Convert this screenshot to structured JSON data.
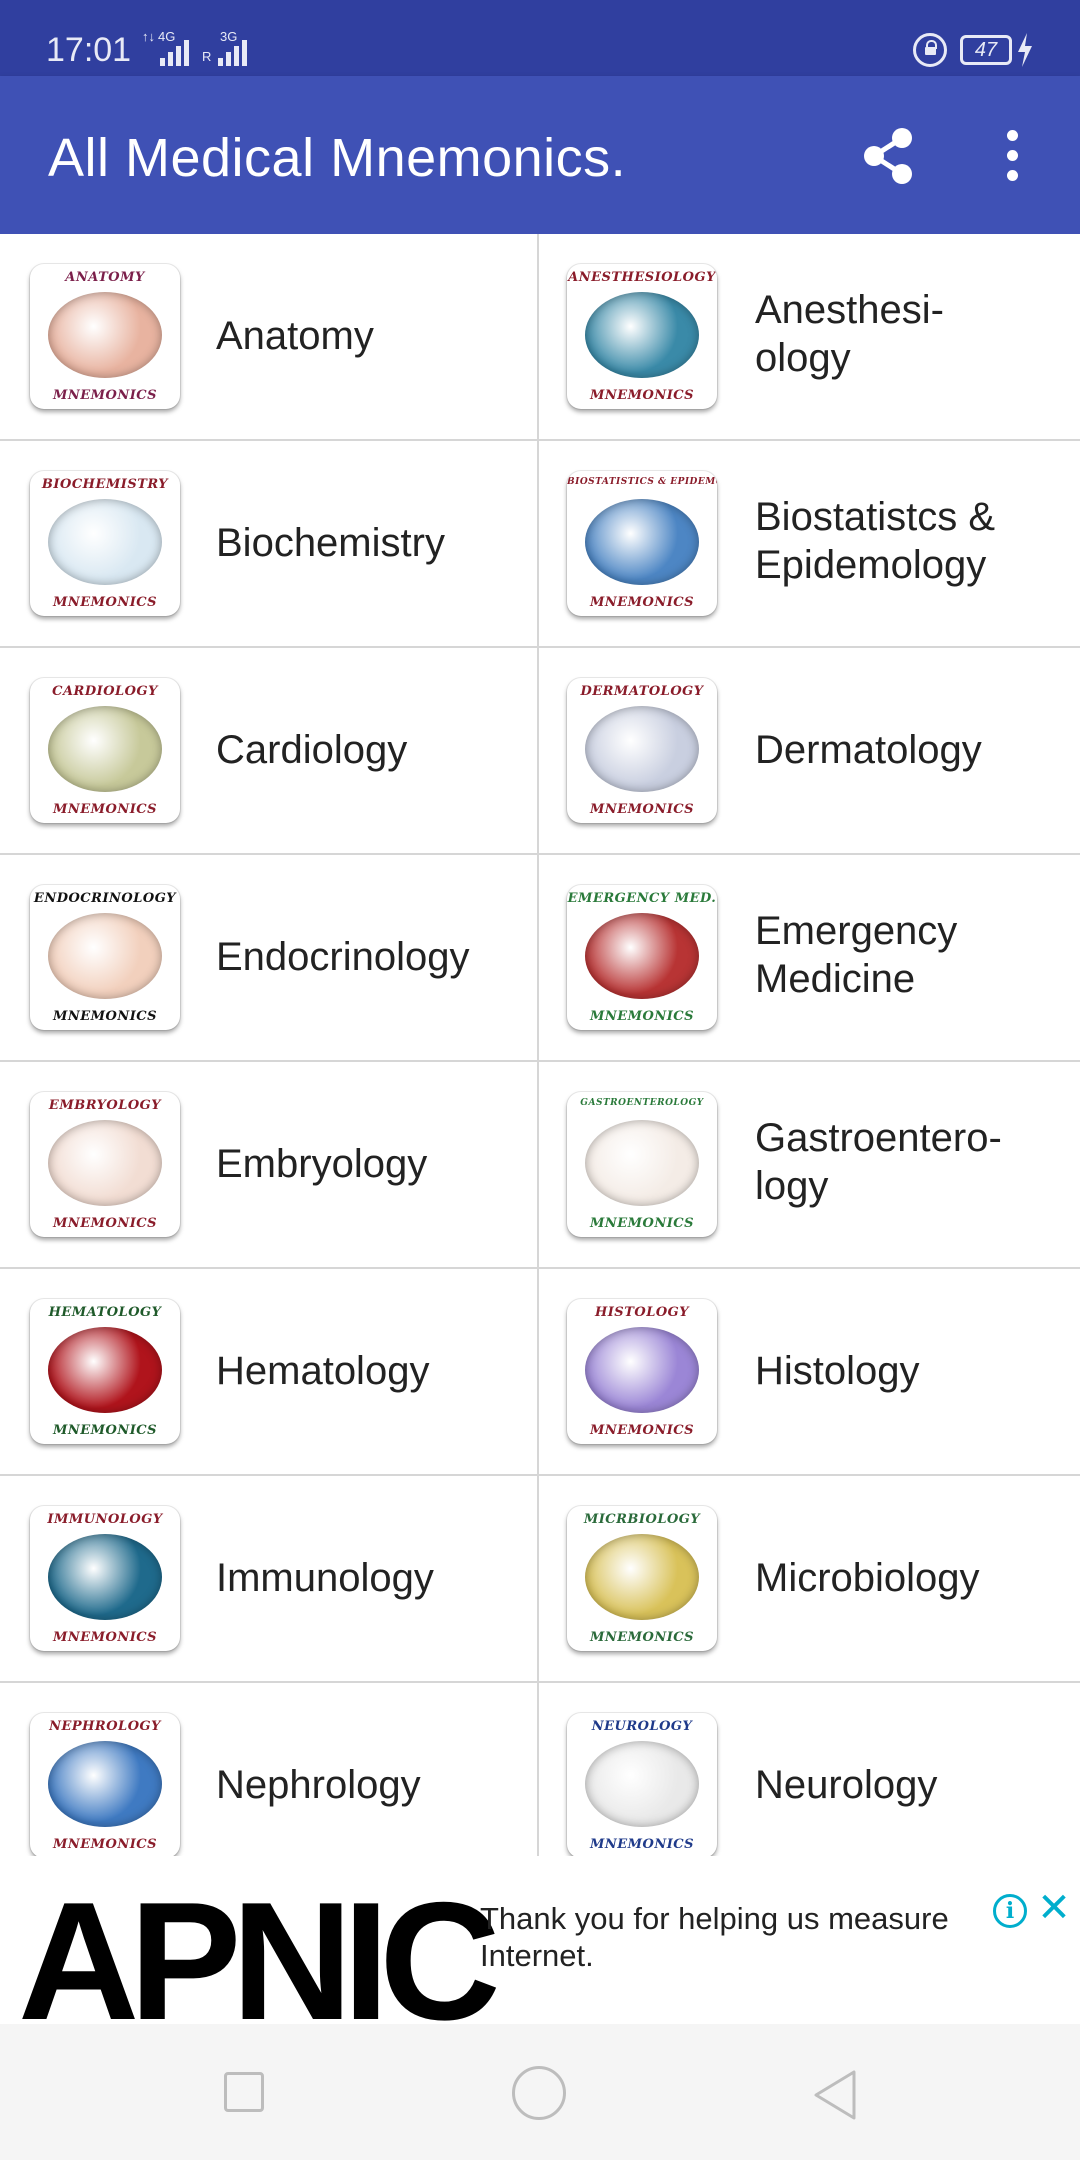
{
  "status_bar": {
    "time": "17:01",
    "signal1_label_top": "4G",
    "signal1_label_left": "↑↓",
    "signal2_label_top": "3G",
    "signal2_label_left": "R",
    "battery": "47"
  },
  "app_bar": {
    "title": "All Medical Mnemonics.",
    "share_icon": "share-icon",
    "more_icon": "more-vert-icon"
  },
  "categories": [
    {
      "label": "Anatomy",
      "banner": "ANATOMY",
      "footer": "MNEMONICS",
      "banner_color": "#7b1f4a",
      "disc": "#e8b3a0"
    },
    {
      "label": "Anesthesi-\nology",
      "banner": "ANESTHESIOLOGY",
      "footer": "MNEMONICS",
      "banner_color": "#8a1c2a",
      "disc": "#3a8aa8"
    },
    {
      "label": "Biochemistry",
      "banner": "BIOCHEMISTRY",
      "footer": "MNEMONICS",
      "banner_color": "#8a1c2a",
      "disc": "#d9e8f2"
    },
    {
      "label": "Biostatistcs &\nEpidemology",
      "banner": "BIOSTATISTICS & EPIDEMOLOGY",
      "footer": "MNEMONICS",
      "banner_color": "#8a1c2a",
      "disc": "#4d86c4"
    },
    {
      "label": "Cardiology",
      "banner": "CARDIOLOGY",
      "footer": "MNEMONICS",
      "banner_color": "#8a1c2a",
      "disc": "#c7c99a"
    },
    {
      "label": "Dermatology",
      "banner": "DERMATOLOGY",
      "footer": "MNEMONICS",
      "banner_color": "#8a1c2a",
      "disc": "#c9cfe0"
    },
    {
      "label": "Endocrinology",
      "banner": "ENDOCRINOLOGY",
      "footer": "MNEMONICS",
      "banner_color": "#111111",
      "disc": "#f2d0bd"
    },
    {
      "label": "Emergency\nMedicine",
      "banner": "EMERGENCY MED.",
      "footer": "MNEMONICS",
      "banner_color": "#2a7a3a",
      "disc": "#b83434"
    },
    {
      "label": "Embryology",
      "banner": "EMBRYOLOGY",
      "footer": "MNEMONICS",
      "banner_color": "#8a1c2a",
      "disc": "#f2ddd3"
    },
    {
      "label": "Gastroentero-\nlogy",
      "banner": "GASTROENTEROLOGY",
      "footer": "MNEMONICS",
      "banner_color": "#2a7a3a",
      "disc": "#f4ece6"
    },
    {
      "label": "Hematology",
      "banner": "HEMATOLOGY",
      "footer": "MNEMONICS",
      "banner_color": "#1f5a2a",
      "disc": "#b0141c"
    },
    {
      "label": "Histology",
      "banner": "HISTOLOGY",
      "footer": "MNEMONICS",
      "banner_color": "#8a1c2a",
      "disc": "#9b86d6"
    },
    {
      "label": "Immunology",
      "banner": "IMMUNOLOGY",
      "footer": "MNEMONICS",
      "banner_color": "#8a1c2a",
      "disc": "#1f6a8c"
    },
    {
      "label": "Microbiology",
      "banner": "MICRBIOLOGY",
      "footer": "MNEMONICS",
      "banner_color": "#2a6a3a",
      "disc": "#d9c25a"
    },
    {
      "label": "Nephrology",
      "banner": "NEPHROLOGY",
      "footer": "MNEMONICS",
      "banner_color": "#8a1c2a",
      "disc": "#3f7ac2"
    },
    {
      "label": "Neurology",
      "banner": "NEUROLOGY",
      "footer": "MNEMONICS",
      "banner_color": "#1f3a8a",
      "disc": "#e9e9e9"
    }
  ],
  "ad": {
    "brand": "APNIC",
    "message": "Thank you for helping us measure Internet.",
    "info_icon": "info-icon",
    "close_icon": "close-icon",
    "accent": "#00aecd"
  },
  "nav_bar": {
    "recent_icon": "recents-square-icon",
    "home_icon": "home-circle-icon",
    "back_icon": "back-triangle-icon"
  },
  "colors": {
    "status_bar": "#303f9f",
    "app_bar": "#3f51b5",
    "divider": "#d6d6d6"
  }
}
